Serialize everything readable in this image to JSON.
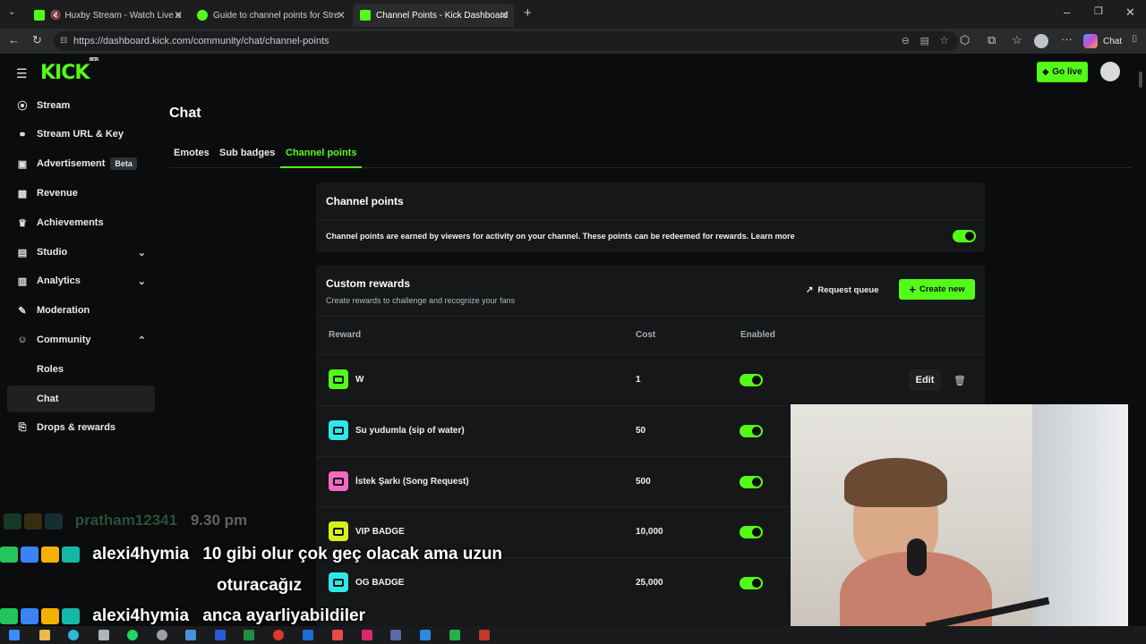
{
  "browser": {
    "tabs": [
      {
        "label": "Huxby Stream - Watch Live o"
      },
      {
        "label": "Guide to channel points for Strear"
      },
      {
        "label": "Channel Points - Kick Dashboard"
      }
    ],
    "url": "https://dashboard.kick.com/community/chat/channel-points",
    "chat_button": "Chat"
  },
  "header": {
    "logo": "KICK",
    "logo_badge": "BETA",
    "go_live": "Go live"
  },
  "sidebar": {
    "items": [
      {
        "label": "Stream",
        "icon": "broadcast-icon"
      },
      {
        "label": "Stream URL & Key",
        "icon": "link-icon"
      },
      {
        "label": "Advertisement",
        "icon": "ad-icon",
        "badge": "Beta"
      },
      {
        "label": "Revenue",
        "icon": "revenue-icon"
      },
      {
        "label": "Achievements",
        "icon": "trophy-icon"
      },
      {
        "label": "Studio",
        "icon": "studio-icon"
      },
      {
        "label": "Analytics",
        "icon": "analytics-icon"
      },
      {
        "label": "Moderation",
        "icon": "wrench-icon"
      },
      {
        "label": "Community",
        "icon": "community-icon"
      }
    ],
    "sub_items": [
      {
        "label": "Roles"
      },
      {
        "label": "Chat"
      }
    ],
    "drops": {
      "label": "Drops & rewards",
      "icon": "gift-icon"
    }
  },
  "main": {
    "title": "Chat",
    "tabs": [
      {
        "label": "Emotes"
      },
      {
        "label": "Sub badges"
      },
      {
        "label": "Channel points"
      }
    ],
    "channel_points": {
      "heading": "Channel points",
      "description": "Channel points are earned by viewers for activity on your channel. These points can be redeemed for rewards.",
      "learn_more": "Learn more",
      "enabled": true
    },
    "custom_rewards": {
      "heading": "Custom rewards",
      "subtitle": "Create rewards to challenge and recognize your fans",
      "request_queue": "Request queue",
      "create_new": "Create new",
      "columns": [
        "Reward",
        "Cost",
        "Enabled"
      ],
      "rows": [
        {
          "name": "W",
          "cost": "1",
          "color": "#53fc18",
          "edit": "Edit"
        },
        {
          "name": "Su yudumla (sip of water)",
          "cost": "50",
          "color": "#2ee8e8"
        },
        {
          "name": "İstek Şarkı (Song Request)",
          "cost": "500",
          "color": "#f06bc0"
        },
        {
          "name": "VIP BADGE",
          "cost": "10,000",
          "color": "#d8f01a"
        },
        {
          "name": "OG BADGE",
          "cost": "25,000",
          "color": "#2ee8e8"
        }
      ]
    }
  },
  "overlay_chat": [
    {
      "user": "pratham12341",
      "text": "9.30 pm"
    },
    {
      "user": "alexi4hymia",
      "text": "10 gibi olur çok geç olacak ama uzun",
      "text2": "oturacağız"
    },
    {
      "user": "alexi4hymia",
      "text": "anca ayarliyabildiler"
    }
  ],
  "colors": {
    "accent": "#53fc18",
    "background": "#0b0c0d",
    "card": "#151718"
  }
}
